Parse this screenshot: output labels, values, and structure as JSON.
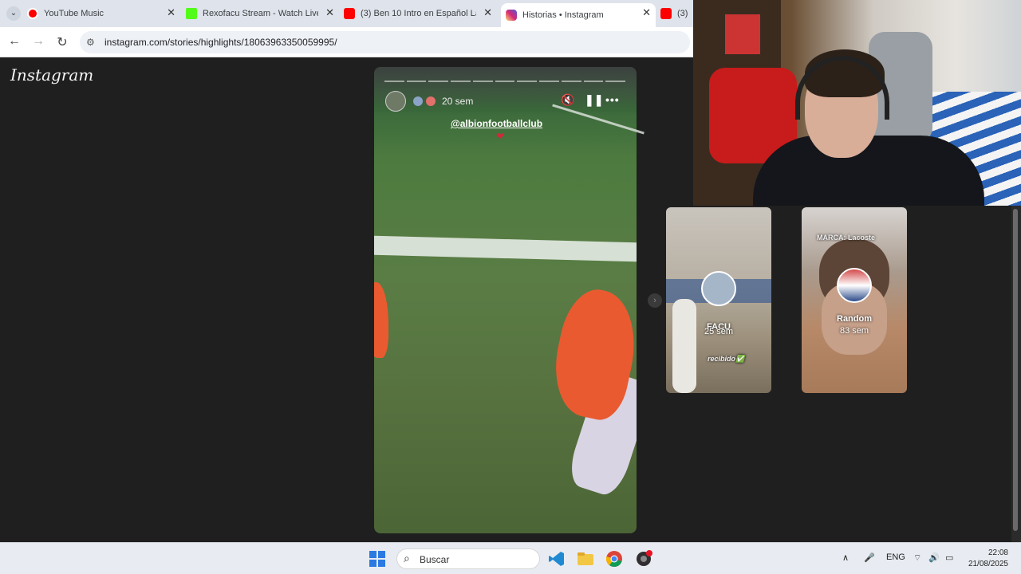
{
  "browser": {
    "tabs": [
      {
        "title": "YouTube Music",
        "color": "#ff0000"
      },
      {
        "title": "Rexofacu Stream - Watch Live o",
        "color": "#53fc18"
      },
      {
        "title": "(3) Ben 10 Intro en Español Lat",
        "color": "#ff0000"
      },
      {
        "title": "Historias • Instagram",
        "color": "#d62976",
        "active": true
      },
      {
        "title": "(3)",
        "color": "#ff0000"
      }
    ],
    "url": "instagram.com/stories/highlights/18063963350059995/"
  },
  "instagram": {
    "logo": "Instagram",
    "story": {
      "time": "20 sem",
      "mention": "@albionfootballclub",
      "heart": "❤",
      "progress_segments": 11
    },
    "highlights": [
      {
        "title": "FACU",
        "time": "25 sem",
        "caption": "recibido✅"
      },
      {
        "title": "Random",
        "time": "83 sem",
        "caption": "MARCA: Lacoste"
      }
    ]
  },
  "taskbar": {
    "search_label": "Buscar",
    "language": "ENG",
    "time": "22:08",
    "date": "21/08/2025"
  }
}
